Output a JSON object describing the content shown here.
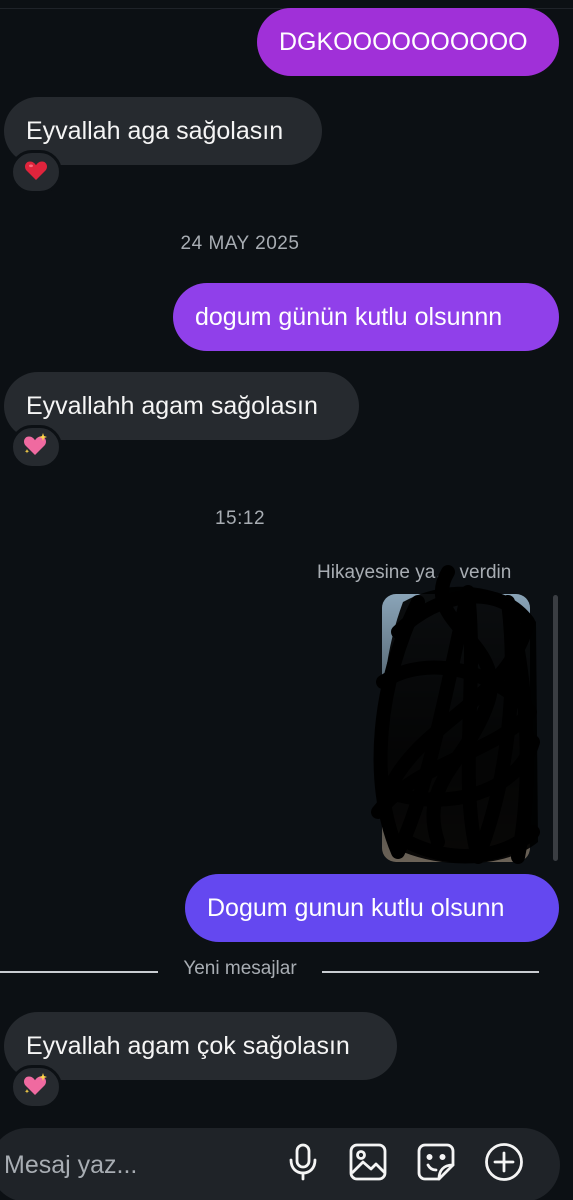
{
  "messages": [
    {
      "id": "m1",
      "direction": "out",
      "text": "DGKOOOOOOOOOO"
    },
    {
      "id": "m2",
      "direction": "in",
      "text": "Eyvallah aga sağolasın",
      "reaction": "red-heart-emoji"
    },
    {
      "id": "m3",
      "direction": "out",
      "text": "dogum günün kutlu olsunnn"
    },
    {
      "id": "m4",
      "direction": "in",
      "text": "Eyvallahh agam sağolasın",
      "reaction": "sparkling-heart-emoji"
    },
    {
      "id": "m5",
      "direction": "out",
      "text": "Dogum gunun kutlu olsunn"
    },
    {
      "id": "m6",
      "direction": "in",
      "text": "Eyvallah agam çok sağolasın",
      "reaction": "sparkling-heart-emoji"
    }
  ],
  "timestamps": {
    "date": "24 MAY 2025",
    "time": "15:12"
  },
  "story_reply": {
    "note": "Hikayesine ya… verdin"
  },
  "divider": {
    "label": "Yeni mesajlar"
  },
  "composer": {
    "placeholder": "Mesaj yaz...",
    "icons": [
      "microphone-icon",
      "image-icon",
      "sticker-icon",
      "plus-icon"
    ]
  },
  "colors": {
    "background": "#0c1014",
    "incoming_bubble": "#262a2f",
    "outgoing_purple": "#a030d8",
    "outgoing_violet": "#9040ea",
    "outgoing_indigo": "#6448f0",
    "reaction_red": "#e0243c",
    "reaction_pink": "#f06aa0"
  }
}
